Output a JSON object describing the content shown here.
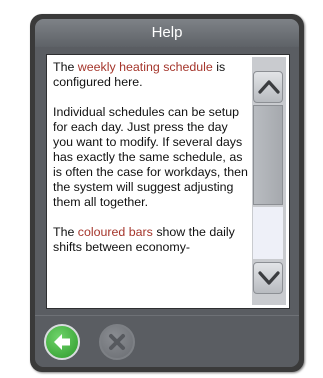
{
  "window": {
    "title": "Help"
  },
  "help": {
    "p1_before": "The ",
    "p1_link": "weekly heating schedule",
    "p1_after": " is configured here.",
    "p2": "Individual schedules can be setup for each day. Just press the day you want to modify. If several days has exactly the same schedule, as is often the case for workdays, then the system will suggest adjusting them all together.",
    "p3_before": "The ",
    "p3_link": "coloured bars",
    "p3_after": " show the daily shifts between economy-"
  },
  "colors": {
    "highlight": "#a5362c",
    "back_button": "#3fae3b",
    "frame": "#3a3a3a"
  },
  "icons": {
    "scroll_up": "chevron-up-icon",
    "scroll_down": "chevron-down-icon",
    "back": "arrow-left-icon",
    "cancel": "close-icon"
  }
}
